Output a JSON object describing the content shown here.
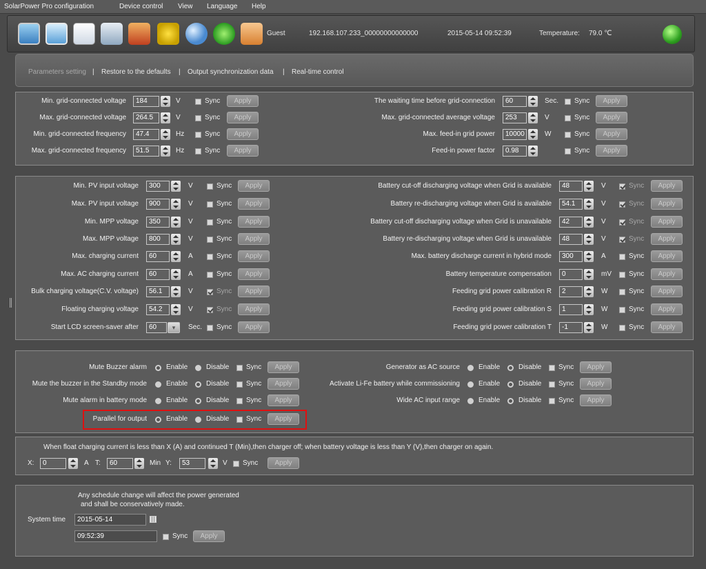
{
  "menu": [
    "SolarPower Pro configuration",
    "Device control",
    "View",
    "Language",
    "Help"
  ],
  "toolbar": {
    "icons": [
      "computer-icon",
      "config-tools-icon",
      "document-icon",
      "devices-icon",
      "battery-icon",
      "hazard-icon",
      "search-icon",
      "refresh-icon",
      "users-icon"
    ],
    "user": "Guest",
    "device": "192.168.107.233_00000000000000",
    "datetime": "2015-05-14 09:52:39",
    "temperature_label": "Temperature:",
    "temperature_value": "79.0 ℃"
  },
  "tabs": [
    "Parameters setting",
    "|",
    "Restore to the defaults",
    "|",
    "Output synchronization data",
    "|",
    "Real-time control"
  ],
  "common": {
    "sync": "Sync",
    "apply": "Apply",
    "enable": "Enable",
    "disable": "Disable"
  },
  "grid": {
    "left": [
      {
        "label": "Min. grid-connected voltage",
        "value": "184",
        "unit": "V"
      },
      {
        "label": "Max. grid-connected voltage",
        "value": "264.5",
        "unit": "V"
      },
      {
        "label": "Min. grid-connected frequency",
        "value": "47.4",
        "unit": "Hz"
      },
      {
        "label": "Max. grid-connected frequency",
        "value": "51.5",
        "unit": "Hz"
      }
    ],
    "right": [
      {
        "label": "The waiting time before grid-connection",
        "value": "60",
        "unit": "Sec."
      },
      {
        "label": "Max. grid-connected average voltage",
        "value": "253",
        "unit": "V"
      },
      {
        "label": "Max. feed-in grid power",
        "value": "10000",
        "unit": "W"
      },
      {
        "label": "Feed-in power factor",
        "value": "0.98",
        "unit": ""
      }
    ]
  },
  "pv": {
    "left": [
      {
        "label": "Min. PV input voltage",
        "value": "300",
        "unit": "V",
        "sync": false
      },
      {
        "label": "Max. PV input voltage",
        "value": "900",
        "unit": "V",
        "sync": false
      },
      {
        "label": "Min. MPP voltage",
        "value": "350",
        "unit": "V",
        "sync": false
      },
      {
        "label": "Max. MPP voltage",
        "value": "800",
        "unit": "V",
        "sync": false
      },
      {
        "label": "Max. charging current",
        "value": "60",
        "unit": "A",
        "sync": false
      },
      {
        "label": "Max. AC charging current",
        "value": "60",
        "unit": "A",
        "sync": false
      },
      {
        "label": "Bulk charging voltage(C.V. voltage)",
        "value": "56.1",
        "unit": "V",
        "sync": true
      },
      {
        "label": "Floating charging voltage",
        "value": "54.2",
        "unit": "V",
        "sync": true
      }
    ],
    "screensaver": {
      "label": "Start LCD screen-saver after",
      "value": "60",
      "unit": "Sec."
    },
    "right": [
      {
        "label": "Battery cut-off discharging voltage when Grid is available",
        "value": "48",
        "unit": "V",
        "sync": true
      },
      {
        "label": "Battery re-discharging voltage when Grid is available",
        "value": "54.1",
        "unit": "V",
        "sync": true
      },
      {
        "label": "Battery cut-off discharging voltage when Grid is unavailable",
        "value": "42",
        "unit": "V",
        "sync": true
      },
      {
        "label": "Battery re-discharging voltage when Grid is unavailable",
        "value": "48",
        "unit": "V",
        "sync": true
      },
      {
        "label": "Max. battery discharge current in hybrid mode",
        "value": "300",
        "unit": "A",
        "sync": false
      },
      {
        "label": "Battery temperature compensation",
        "value": "0",
        "unit": "mV",
        "sync": false
      },
      {
        "label": "Feeding grid power calibration R",
        "value": "2",
        "unit": "W",
        "sync": false
      },
      {
        "label": "Feeding grid power calibration S",
        "value": "1",
        "unit": "W",
        "sync": false
      },
      {
        "label": "Feeding grid power calibration T",
        "value": "-1",
        "unit": "W",
        "sync": false
      }
    ]
  },
  "toggles": {
    "left": [
      {
        "label": "Mute Buzzer alarm",
        "enabled": true
      },
      {
        "label": "Mute the buzzer in the Standby mode",
        "enabled": false
      },
      {
        "label": "Mute alarm in battery mode",
        "enabled": false
      },
      {
        "label": "Parallel for output",
        "enabled": true
      }
    ],
    "right": [
      {
        "label": "Generator as AC source",
        "enabled": false
      },
      {
        "label": "Activate Li-Fe battery while commissioning",
        "enabled": false
      },
      {
        "label": "Wide AC input range",
        "enabled": false
      }
    ]
  },
  "charger": {
    "description": "When float charging current is less than X (A) and continued T (Min),then charger off; when battery voltage is less than Y (V),then charger on again.",
    "x_label": "X:",
    "x_value": "0",
    "x_unit": "A",
    "t_label": "T:",
    "t_value": "60",
    "t_unit": "Min",
    "y_label": "Y:",
    "y_value": "53",
    "y_unit": "V"
  },
  "schedule": {
    "note1": "Any schedule change will affect the power generated",
    "note2": "and shall be conservatively made.",
    "system_time_label": "System time",
    "date": "2015-05-14",
    "time": "09:52:39"
  }
}
